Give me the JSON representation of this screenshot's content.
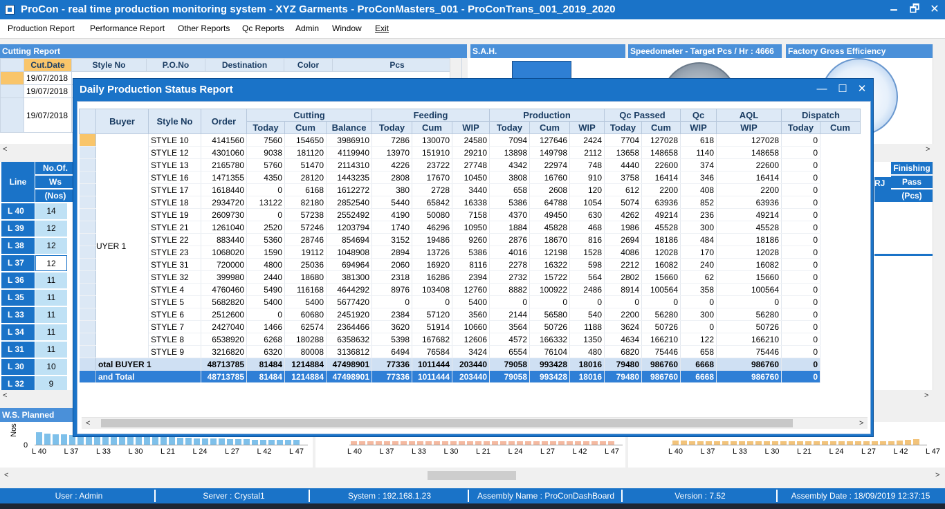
{
  "app": {
    "title": "ProCon - real time production monitoring system - XYZ Garments - ProConMasters_001 - ProConTrans_001_2019_2020",
    "minimize": "🗕",
    "maximize": "🗗",
    "close": "✕"
  },
  "menu": [
    "Production Report",
    "Performance Report",
    "Other Reports",
    "Qc Reports",
    "Admin",
    "Window",
    "Exit"
  ],
  "panels": {
    "cutting": "Cutting Report",
    "sah": "S.A.H.",
    "speedometer": "Speedometer - Target Pcs / Hr : 4666",
    "factory": "Factory Gross Efficiency",
    "ws_planned": "W.S. Planned"
  },
  "cutting_report": {
    "columns": [
      "Cut.Date",
      "Style No",
      "P.O.No",
      "Destination",
      "Color",
      "Pcs"
    ],
    "dates": [
      "19/07/2018",
      "19/07/2018",
      "19/07/2018"
    ]
  },
  "lines_panel": {
    "header_line": "Line",
    "header_ws1": "No.Of.",
    "header_ws2": "Ws",
    "header_ws3": "(Nos)",
    "finishing": "Finishing",
    "pass": "Pass",
    "pcs": "(Pcs)",
    "rj": "RJ",
    "rows": [
      {
        "line": "L 40",
        "ws": "14"
      },
      {
        "line": "L 39",
        "ws": "12"
      },
      {
        "line": "L 38",
        "ws": "12"
      },
      {
        "line": "L 37",
        "ws": "12"
      },
      {
        "line": "L 36",
        "ws": "11"
      },
      {
        "line": "L 35",
        "ws": "11"
      },
      {
        "line": "L 33",
        "ws": "11"
      },
      {
        "line": "L 34",
        "ws": "11"
      },
      {
        "line": "L 31",
        "ws": "11"
      },
      {
        "line": "L 30",
        "ws": "10"
      },
      {
        "line": "L 32",
        "ws": "9"
      }
    ]
  },
  "charts_bottom": {
    "ylabel": "Nos",
    "zero": "0",
    "x_labels": [
      "L 40",
      "L 37",
      "L 33",
      "L 30",
      "L 21",
      "L 24",
      "L 27",
      "L 42",
      "L 47"
    ]
  },
  "dialog": {
    "title": "Daily Production Status Report",
    "minimize": "—",
    "maximize": "☐",
    "close": "✕",
    "groups": {
      "cutting": "Cutting",
      "feeding": "Feeding",
      "production": "Production",
      "qc_passed": "Qc Passed",
      "qc": "Qc",
      "aql": "AQL",
      "dispatch": "Dispatch"
    },
    "cols": {
      "buyer": "Buyer",
      "style": "Style No",
      "order": "Order",
      "today": "Today",
      "cum": "Cum",
      "balance": "Balance",
      "wip": "WIP"
    },
    "buyer": "UYER 1",
    "rows": [
      [
        "STYLE 10",
        "4141560",
        "7560",
        "154650",
        "3986910",
        "7286",
        "130070",
        "24580",
        "7094",
        "127646",
        "2424",
        "7704",
        "127028",
        "618",
        "127028",
        "0"
      ],
      [
        "STYLE 12",
        "4301060",
        "9038",
        "181120",
        "4119940",
        "13970",
        "151910",
        "29210",
        "13898",
        "149798",
        "2112",
        "13658",
        "148658",
        "1140",
        "148658",
        "0"
      ],
      [
        "STYLE 13",
        "2165780",
        "5760",
        "51470",
        "2114310",
        "4226",
        "23722",
        "27748",
        "4342",
        "22974",
        "748",
        "4440",
        "22600",
        "374",
        "22600",
        "0"
      ],
      [
        "STYLE 16",
        "1471355",
        "4350",
        "28120",
        "1443235",
        "2808",
        "17670",
        "10450",
        "3808",
        "16760",
        "910",
        "3758",
        "16414",
        "346",
        "16414",
        "0"
      ],
      [
        "STYLE 17",
        "1618440",
        "0",
        "6168",
        "1612272",
        "380",
        "2728",
        "3440",
        "658",
        "2608",
        "120",
        "612",
        "2200",
        "408",
        "2200",
        "0"
      ],
      [
        "STYLE 18",
        "2934720",
        "13122",
        "82180",
        "2852540",
        "5440",
        "65842",
        "16338",
        "5386",
        "64788",
        "1054",
        "5074",
        "63936",
        "852",
        "63936",
        "0"
      ],
      [
        "STYLE 19",
        "2609730",
        "0",
        "57238",
        "2552492",
        "4190",
        "50080",
        "7158",
        "4370",
        "49450",
        "630",
        "4262",
        "49214",
        "236",
        "49214",
        "0"
      ],
      [
        "STYLE 21",
        "1261040",
        "2520",
        "57246",
        "1203794",
        "1740",
        "46296",
        "10950",
        "1884",
        "45828",
        "468",
        "1986",
        "45528",
        "300",
        "45528",
        "0"
      ],
      [
        "STYLE 22",
        "883440",
        "5360",
        "28746",
        "854694",
        "3152",
        "19486",
        "9260",
        "2876",
        "18670",
        "816",
        "2694",
        "18186",
        "484",
        "18186",
        "0"
      ],
      [
        "STYLE 23",
        "1068020",
        "1590",
        "19112",
        "1048908",
        "2894",
        "13726",
        "5386",
        "4016",
        "12198",
        "1528",
        "4086",
        "12028",
        "170",
        "12028",
        "0"
      ],
      [
        "STYLE 31",
        "720000",
        "4800",
        "25036",
        "694964",
        "2060",
        "16920",
        "8116",
        "2278",
        "16322",
        "598",
        "2212",
        "16082",
        "240",
        "16082",
        "0"
      ],
      [
        "STYLE 32",
        "399980",
        "2440",
        "18680",
        "381300",
        "2318",
        "16286",
        "2394",
        "2732",
        "15722",
        "564",
        "2802",
        "15660",
        "62",
        "15660",
        "0"
      ],
      [
        "STYLE 4",
        "4760460",
        "5490",
        "116168",
        "4644292",
        "8976",
        "103408",
        "12760",
        "8882",
        "100922",
        "2486",
        "8914",
        "100564",
        "358",
        "100564",
        "0"
      ],
      [
        "STYLE 5",
        "5682820",
        "5400",
        "5400",
        "5677420",
        "0",
        "0",
        "5400",
        "0",
        "0",
        "0",
        "0",
        "0",
        "0",
        "0",
        "0"
      ],
      [
        "STYLE 6",
        "2512600",
        "0",
        "60680",
        "2451920",
        "2384",
        "57120",
        "3560",
        "2144",
        "56580",
        "540",
        "2200",
        "56280",
        "300",
        "56280",
        "0"
      ],
      [
        "STYLE 7",
        "2427040",
        "1466",
        "62574",
        "2364466",
        "3620",
        "51914",
        "10660",
        "3564",
        "50726",
        "1188",
        "3624",
        "50726",
        "0",
        "50726",
        "0"
      ],
      [
        "STYLE 8",
        "6538920",
        "6268",
        "180288",
        "6358632",
        "5398",
        "167682",
        "12606",
        "4572",
        "166332",
        "1350",
        "4634",
        "166210",
        "122",
        "166210",
        "0"
      ],
      [
        "STYLE 9",
        "3216820",
        "6320",
        "80008",
        "3136812",
        "6494",
        "76584",
        "3424",
        "6554",
        "76104",
        "480",
        "6820",
        "75446",
        "658",
        "75446",
        "0"
      ]
    ],
    "subtotal": [
      "otal BUYER 1",
      "48713785",
      "81484",
      "1214884",
      "47498901",
      "77336",
      "1011444",
      "203440",
      "79058",
      "993428",
      "18016",
      "79480",
      "986760",
      "6668",
      "986760",
      "0"
    ],
    "grandtotal": [
      "and Total",
      "48713785",
      "81484",
      "1214884",
      "47498901",
      "77336",
      "1011444",
      "203440",
      "79058",
      "993428",
      "18016",
      "79480",
      "986760",
      "6668",
      "986760",
      "0"
    ]
  },
  "status": {
    "user": "User : Admin",
    "server": "Server : Crystal1",
    "system": "System : 192.168.1.23",
    "assembly": "Assembly Name : ProConDashBoard",
    "version": "Version : 7.52",
    "date": "Assembly Date : 18/09/2019 12:37:15"
  },
  "colors": {
    "accent": "#1a73c8",
    "selected_row": "#2f7fd6",
    "subtotal": "#cfe0f3",
    "header": "#dde9f6"
  }
}
